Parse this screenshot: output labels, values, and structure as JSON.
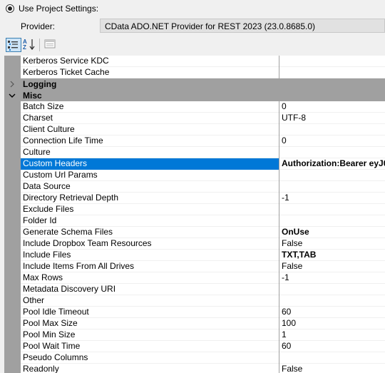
{
  "header": {
    "radio_label": "Use Project Settings:",
    "provider_label": "Provider:",
    "provider_value": "CData ADO.NET Provider for REST 2023 (23.0.8685.0)"
  },
  "toolbar": {
    "buttons": [
      "categorized-icon",
      "alphabetical-icon",
      "property-pages-icon"
    ]
  },
  "grid": {
    "rows": [
      {
        "type": "prop",
        "name": "Kerberos Service KDC",
        "value": ""
      },
      {
        "type": "prop",
        "name": "Kerberos Ticket Cache",
        "value": ""
      },
      {
        "type": "category",
        "name": "Logging",
        "expanded": false
      },
      {
        "type": "category",
        "name": "Misc",
        "expanded": true
      },
      {
        "type": "prop",
        "name": "Batch Size",
        "value": "0"
      },
      {
        "type": "prop",
        "name": "Charset",
        "value": "UTF-8"
      },
      {
        "type": "prop",
        "name": "Client Culture",
        "value": ""
      },
      {
        "type": "prop",
        "name": "Connection Life Time",
        "value": "0"
      },
      {
        "type": "prop",
        "name": "Culture",
        "value": ""
      },
      {
        "type": "prop",
        "name": "Custom Headers",
        "value": "Authorization:Bearer eyJ0",
        "bold": true,
        "selected": true
      },
      {
        "type": "prop",
        "name": "Custom Url Params",
        "value": ""
      },
      {
        "type": "prop",
        "name": "Data Source",
        "value": ""
      },
      {
        "type": "prop",
        "name": "Directory Retrieval Depth",
        "value": "-1"
      },
      {
        "type": "prop",
        "name": "Exclude Files",
        "value": ""
      },
      {
        "type": "prop",
        "name": "Folder Id",
        "value": ""
      },
      {
        "type": "prop",
        "name": "Generate Schema Files",
        "value": "OnUse",
        "bold": true
      },
      {
        "type": "prop",
        "name": "Include Dropbox Team Resources",
        "value": "False"
      },
      {
        "type": "prop",
        "name": "Include Files",
        "value": "TXT,TAB",
        "bold": true
      },
      {
        "type": "prop",
        "name": "Include Items From All Drives",
        "value": "False"
      },
      {
        "type": "prop",
        "name": "Max Rows",
        "value": "-1"
      },
      {
        "type": "prop",
        "name": "Metadata Discovery URI",
        "value": ""
      },
      {
        "type": "prop",
        "name": "Other",
        "value": ""
      },
      {
        "type": "prop",
        "name": "Pool Idle Timeout",
        "value": "60"
      },
      {
        "type": "prop",
        "name": "Pool Max Size",
        "value": "100"
      },
      {
        "type": "prop",
        "name": "Pool Min Size",
        "value": "1"
      },
      {
        "type": "prop",
        "name": "Pool Wait Time",
        "value": "60"
      },
      {
        "type": "prop",
        "name": "Pseudo Columns",
        "value": ""
      },
      {
        "type": "prop",
        "name": "Readonly",
        "value": "False"
      }
    ]
  }
}
